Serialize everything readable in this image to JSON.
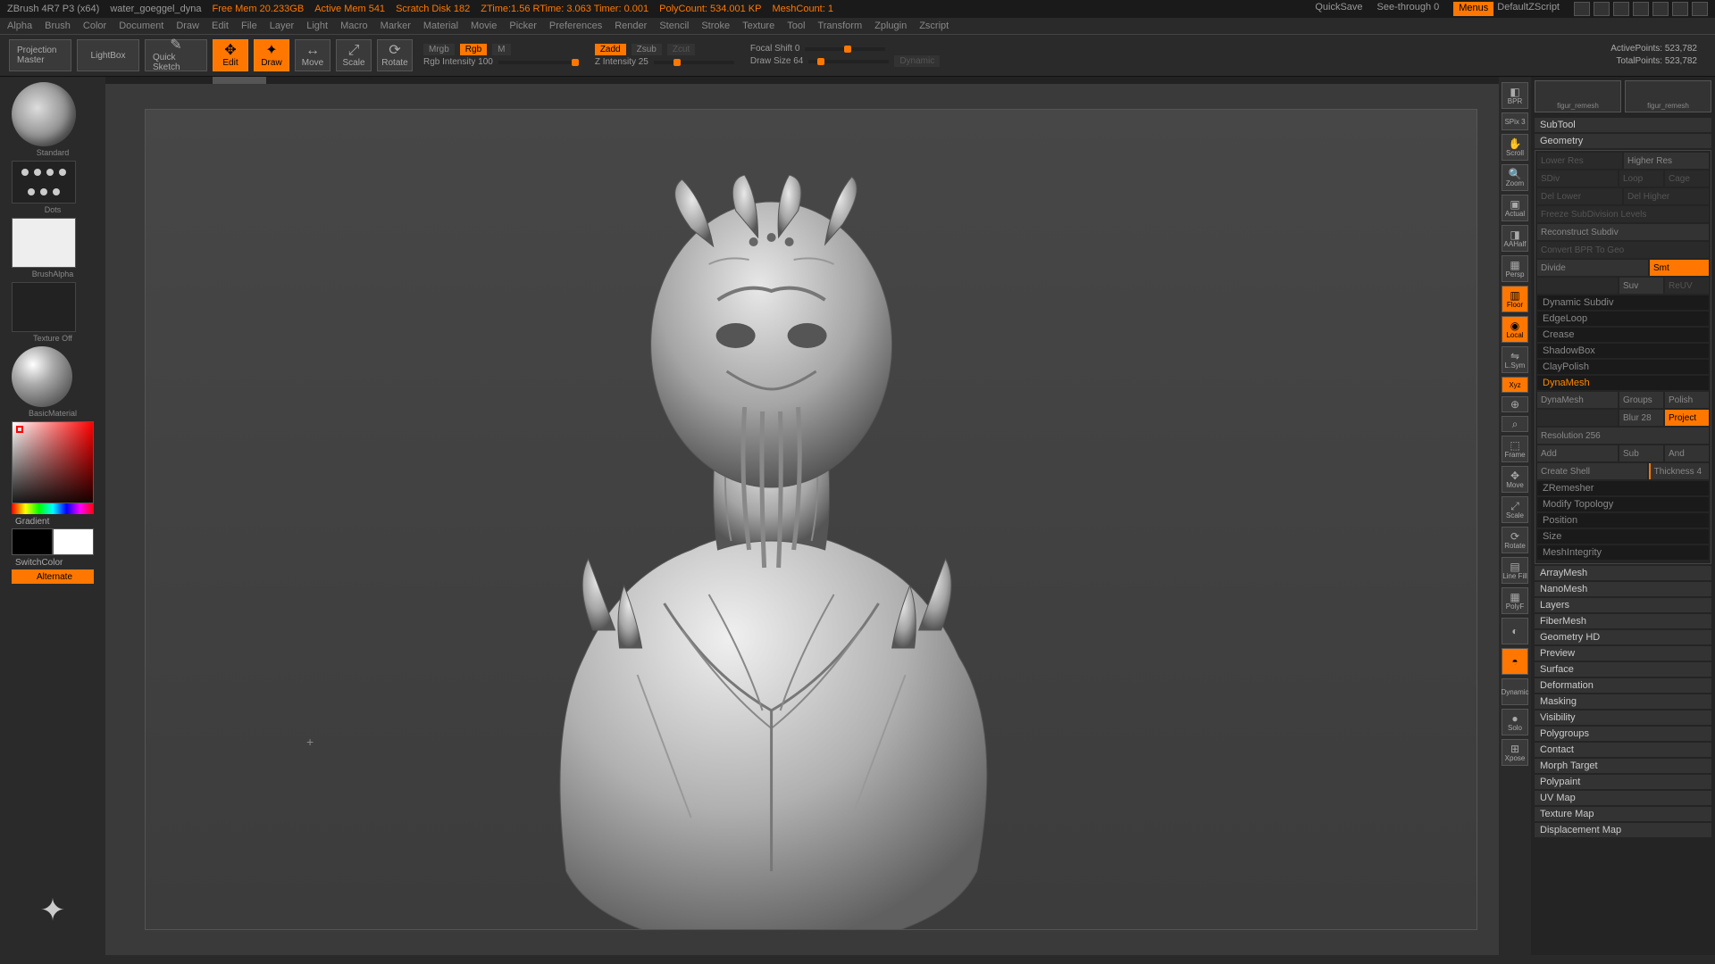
{
  "titlebar": {
    "app": "ZBrush 4R7 P3 (x64)",
    "doc": "water_goeggel_dyna",
    "freemem": "Free Mem 20.233GB",
    "activemem": "Active Mem 541",
    "scratch": "Scratch Disk 182",
    "ztime": "ZTime:1.56 RTime: 3.063 Timer: 0.001",
    "polycount": "PolyCount: 534.001 KP",
    "meshcount": "MeshCount: 1",
    "quicksave": "QuickSave",
    "seethrough": "See-through  0",
    "menus": "Menus",
    "script": "DefaultZScript"
  },
  "menubar": [
    "Alpha",
    "Brush",
    "Color",
    "Document",
    "Draw",
    "Edit",
    "File",
    "Layer",
    "Light",
    "Macro",
    "Marker",
    "Material",
    "Movie",
    "Picker",
    "Preferences",
    "Render",
    "Stencil",
    "Stroke",
    "Texture",
    "Tool",
    "Transform",
    "Zplugin",
    "Zscript"
  ],
  "toolbar": {
    "projection": "Projection Master",
    "lightbox": "LightBox",
    "quicksketch": "Quick Sketch",
    "edit": "Edit",
    "draw": "Draw",
    "move": "Move",
    "scale": "Scale",
    "rotate": "Rotate",
    "mrgb": "Mrgb",
    "rgb": "Rgb",
    "m": "M",
    "rgbint": "Rgb Intensity 100",
    "zadd": "Zadd",
    "zsub": "Zsub",
    "zcut": "Zcut",
    "zint": "Z Intensity 25",
    "focal": "Focal Shift 0",
    "drawsize": "Draw Size 64",
    "dynamic": "Dynamic",
    "active": "ActivePoints: 523,782",
    "total": "TotalPoints: 523,782"
  },
  "left": {
    "brush": "Standard",
    "stroke": "Dots",
    "alpha": "BrushAlpha",
    "texture": "Texture Off",
    "material": "BasicMaterial",
    "gradient": "Gradient",
    "switch": "SwitchColor",
    "alternate": "Alternate"
  },
  "nav": [
    "BPR",
    "SPix 3",
    "Scroll",
    "Zoom",
    "Actual",
    "AAHalf",
    "Persp",
    "Floor",
    "Local",
    "L.Sym",
    "Xyz",
    "",
    "",
    "Frame",
    "Move",
    "Scale",
    "Rotate",
    "Line Fill",
    "PolyF",
    "",
    "",
    "Dynamic",
    "",
    "Solo",
    "Xpose"
  ],
  "right": {
    "preset1": "figur_remesh",
    "preset2": "figur_remesh",
    "subtool": "SubTool",
    "geometry": "Geometry",
    "lowerres": "Lower Res",
    "higherres": "Higher Res",
    "sdiv": "SDiv",
    "loop": "Loop",
    "cage": "Cage",
    "dellower": "Del Lower",
    "delhigher": "Del Higher",
    "freeze": "Freeze SubDivision Levels",
    "reconstruct": "Reconstruct Subdiv",
    "convertbpr": "Convert BPR To Geo",
    "divide": "Divide",
    "smt": "Smt",
    "suv": "Suv",
    "rstr": "ReUV",
    "dynsubdiv": "Dynamic Subdiv",
    "edgeloop": "EdgeLoop",
    "crease": "Crease",
    "shadowbox": "ShadowBox",
    "claypolish": "ClayPolish",
    "dynamesh_h": "DynaMesh",
    "dynamesh_b": "DynaMesh",
    "groups": "Groups",
    "polish": "Polish",
    "blur": "Blur 28",
    "project": "Project",
    "resolution": "Resolution 256",
    "add": "Add",
    "sub": "Sub",
    "and": "And",
    "createshell": "Create Shell",
    "thickness": "Thickness 4",
    "zremesher": "ZRemesher",
    "modtopo": "Modify Topology",
    "position": "Position",
    "size": "Size",
    "meshint": "MeshIntegrity",
    "others": [
      "ArrayMesh",
      "NanoMesh",
      "Layers",
      "FiberMesh",
      "Geometry HD",
      "Preview",
      "Surface",
      "Deformation",
      "Masking",
      "Visibility",
      "Polygroups",
      "Contact",
      "Morph Target",
      "Polypaint",
      "UV Map",
      "Texture Map",
      "Displacement Map"
    ]
  }
}
